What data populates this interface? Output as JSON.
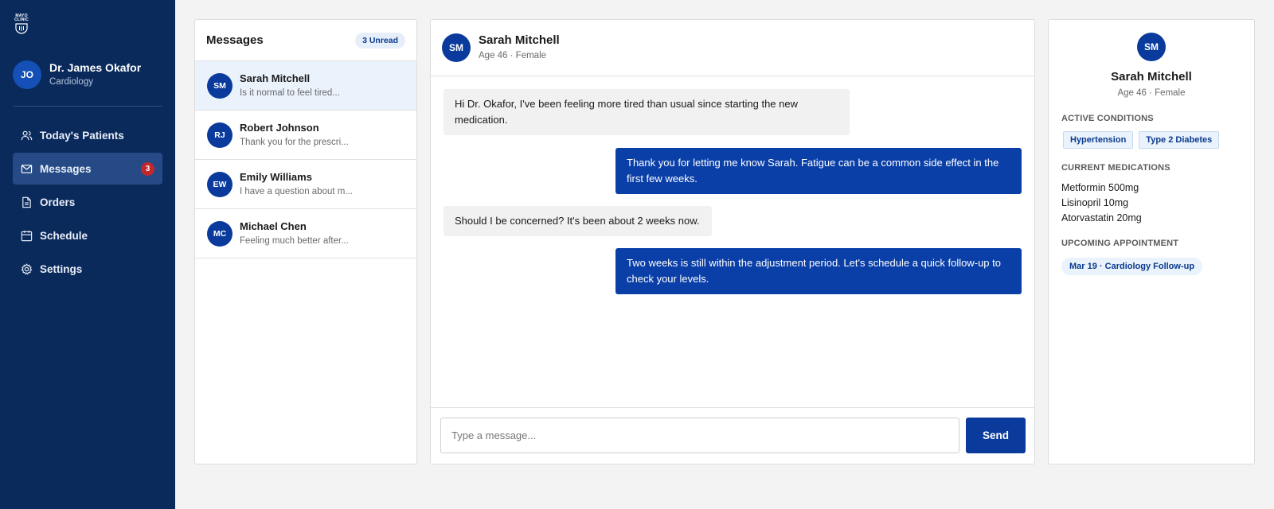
{
  "logo": {
    "text_line1": "MAYO",
    "text_line2": "CLINIC"
  },
  "user": {
    "initials": "JO",
    "name": "Dr. James Okafor",
    "department": "Cardiology"
  },
  "nav": [
    {
      "label": "Today's Patients",
      "icon": "users-icon"
    },
    {
      "label": "Messages",
      "icon": "mail-icon",
      "badge": "3",
      "active": true
    },
    {
      "label": "Orders",
      "icon": "document-icon"
    },
    {
      "label": "Schedule",
      "icon": "calendar-icon"
    },
    {
      "label": "Settings",
      "icon": "gear-icon"
    }
  ],
  "messages_list": {
    "title": "Messages",
    "unread": "3 Unread",
    "conversations": [
      {
        "initials": "SM",
        "name": "Sarah Mitchell",
        "preview": "Is it normal to feel tired..."
      },
      {
        "initials": "RJ",
        "name": "Robert Johnson",
        "preview": "Thank you for the prescri..."
      },
      {
        "initials": "EW",
        "name": "Emily Williams",
        "preview": "I have a question about m..."
      },
      {
        "initials": "MC",
        "name": "Michael Chen",
        "preview": "Feeling much better after..."
      }
    ]
  },
  "chat": {
    "initials": "SM",
    "name": "Sarah Mitchell",
    "subtitle": "Age 46 · Female",
    "messages": [
      {
        "direction": "in",
        "text": "Hi Dr. Okafor, I've been feeling more tired than usual since starting the new medication."
      },
      {
        "direction": "out",
        "text": "Thank you for letting me know Sarah. Fatigue can be a common side effect in the first few weeks."
      },
      {
        "direction": "in",
        "text": "Should I be concerned? It's been about 2 weeks now."
      },
      {
        "direction": "out",
        "text": "Two weeks is still within the adjustment period. Let's schedule a quick follow-up to check your levels."
      }
    ],
    "input_placeholder": "Type a message...",
    "send_label": "Send"
  },
  "patient": {
    "initials": "SM",
    "name": "Sarah Mitchell",
    "subtitle": "Age 46 · Female",
    "conditions_title": "Active Conditions",
    "conditions": [
      "Hypertension",
      "Type 2 Diabetes"
    ],
    "medications_title": "Current Medications",
    "medications": [
      "Metformin 500mg",
      "Lisinopril 10mg",
      "Atorvastatin 20mg"
    ],
    "appointment_title": "Upcoming Appointment",
    "appointment": "Mar 19 · Cardiology Follow-up"
  },
  "colors": {
    "sidebar": "#0a2a5c",
    "primary": "#0a3a9c",
    "badge": "#c0282d",
    "active_row": "#eaf2fc"
  }
}
